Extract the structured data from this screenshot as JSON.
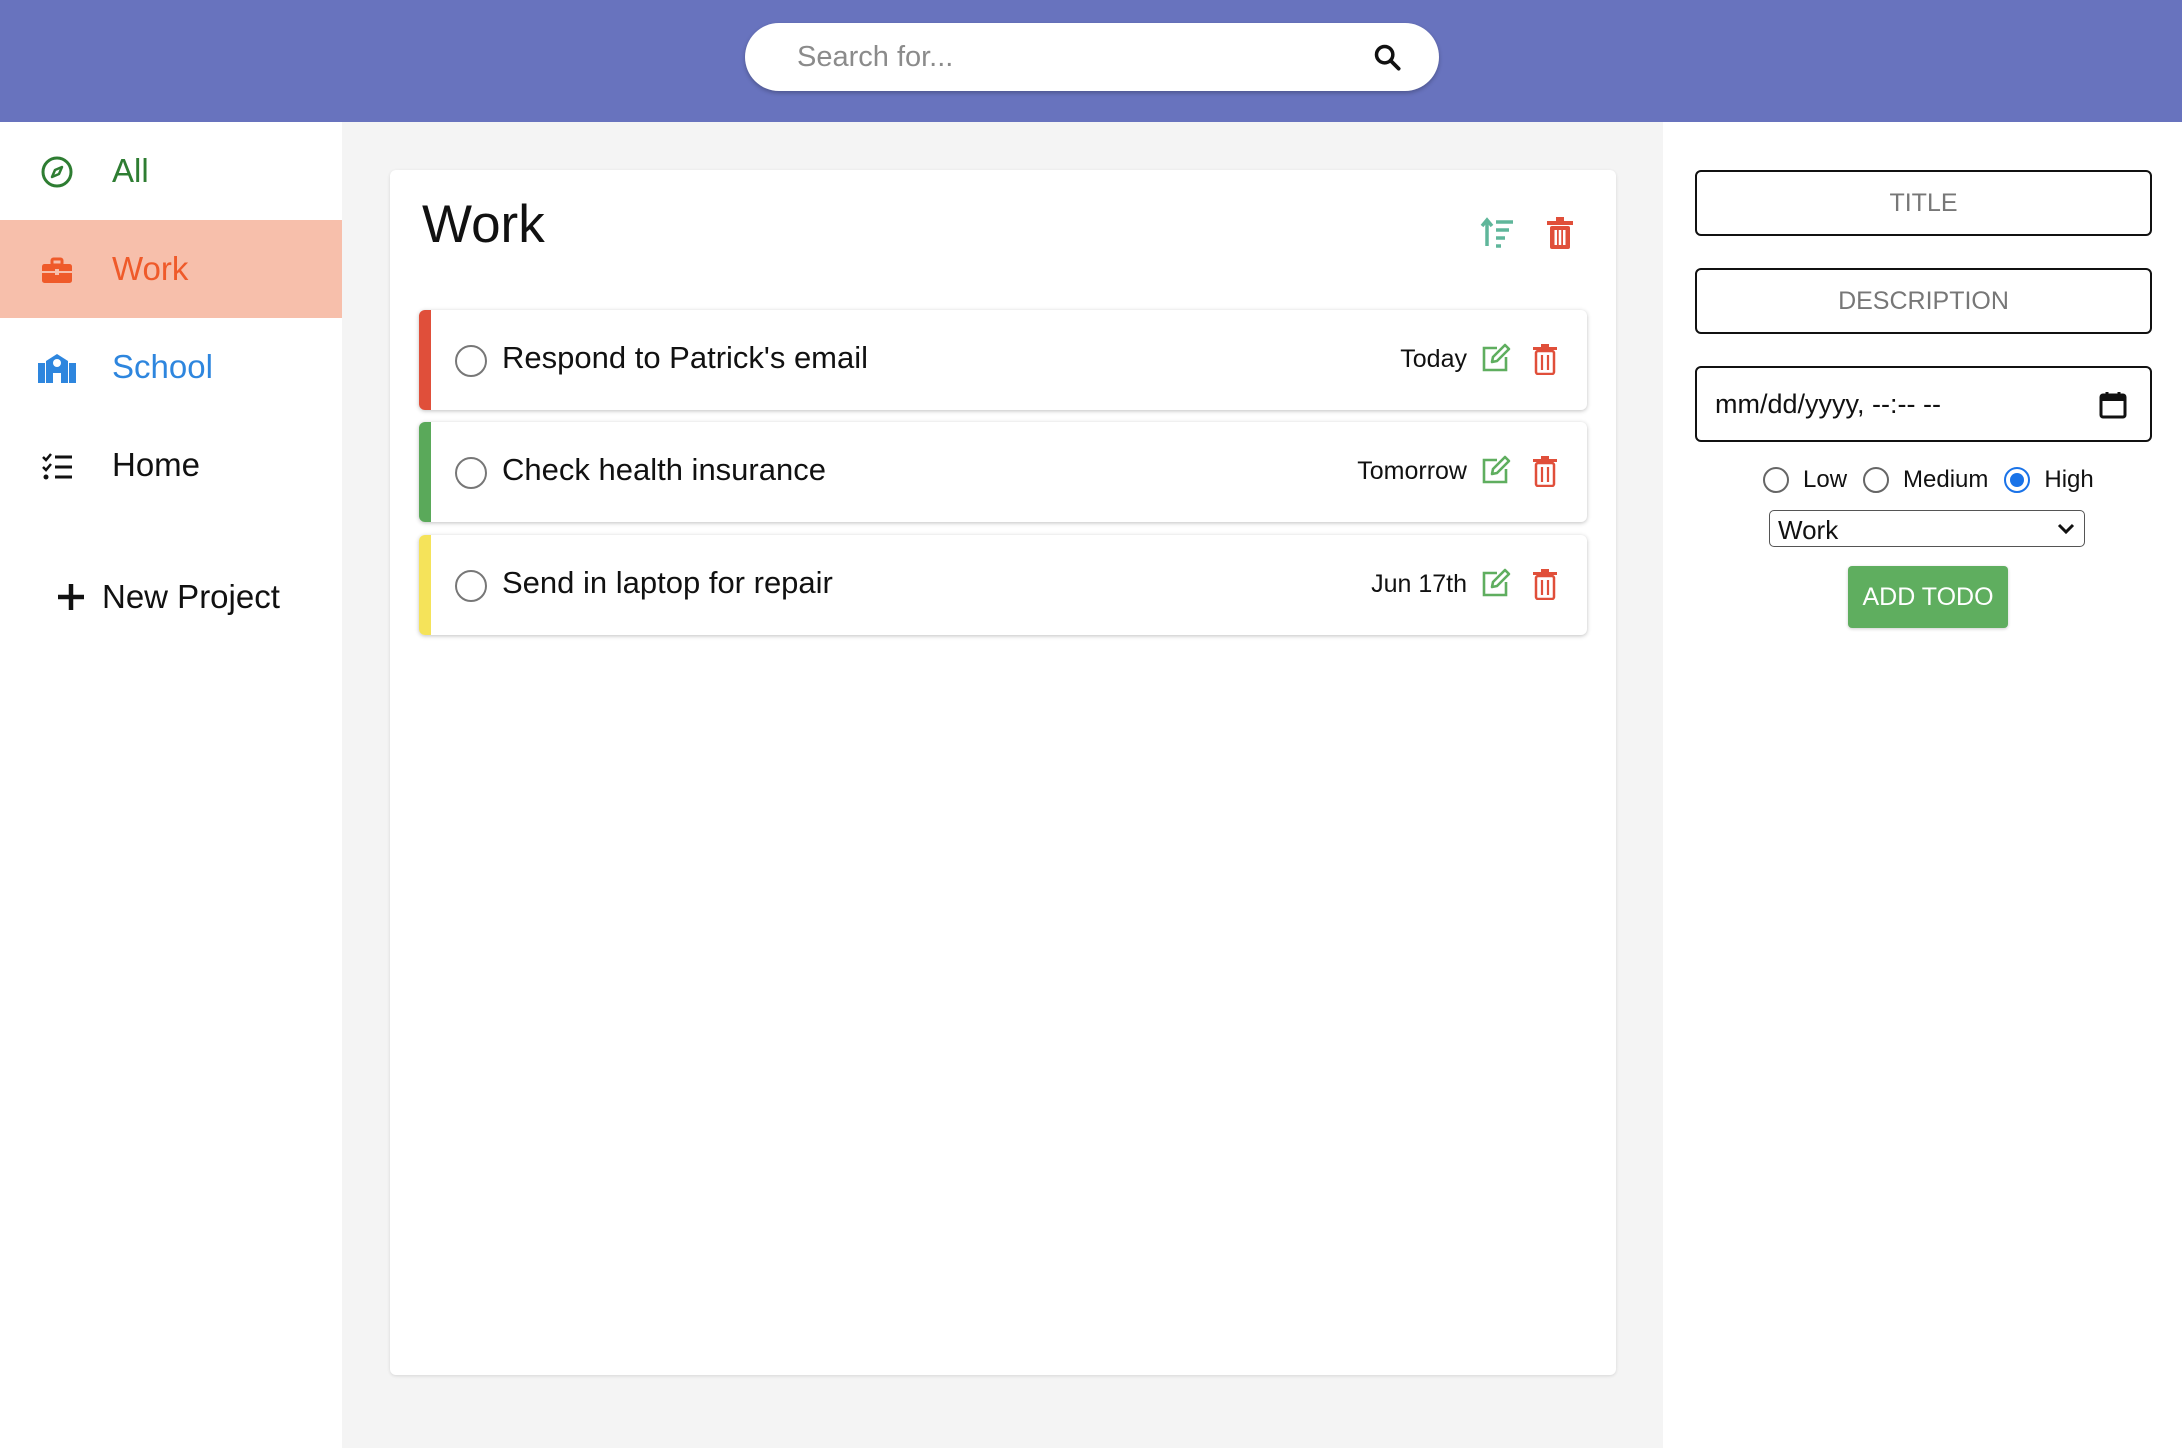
{
  "search": {
    "placeholder": "Search for..."
  },
  "sidebar": {
    "items": [
      {
        "label": "All",
        "icon": "compass-icon",
        "color": "#2e7d32"
      },
      {
        "label": "Work",
        "icon": "briefcase-icon",
        "color": "#ef5a2a",
        "active": true
      },
      {
        "label": "School",
        "icon": "school-icon",
        "color": "#2e86de"
      },
      {
        "label": "Home",
        "icon": "checklist-icon",
        "color": "#111111"
      }
    ],
    "new_project_label": "New Project"
  },
  "project": {
    "title": "Work",
    "todos": [
      {
        "text": "Respond to Patrick's email",
        "date": "Today",
        "priority_color": "#e04f3a"
      },
      {
        "text": "Check health insurance",
        "date": "Tomorrow",
        "priority_color": "#5aa95a"
      },
      {
        "text": "Send in laptop for repair",
        "date": "Jun 17th",
        "priority_color": "#f5e35a"
      }
    ]
  },
  "form": {
    "title_placeholder": "TITLE",
    "description_placeholder": "DESCRIPTION",
    "date_value": "mm/dd/yyyy, --:-- --",
    "priorities": [
      "Low",
      "Medium",
      "High"
    ],
    "selected_priority": "High",
    "project_value": "Work",
    "add_label": "ADD TODO"
  },
  "colors": {
    "header": "#6873be",
    "active_bg": "#f7bfab",
    "accent_green": "#5fae5f",
    "delete_red": "#e04f3a"
  }
}
